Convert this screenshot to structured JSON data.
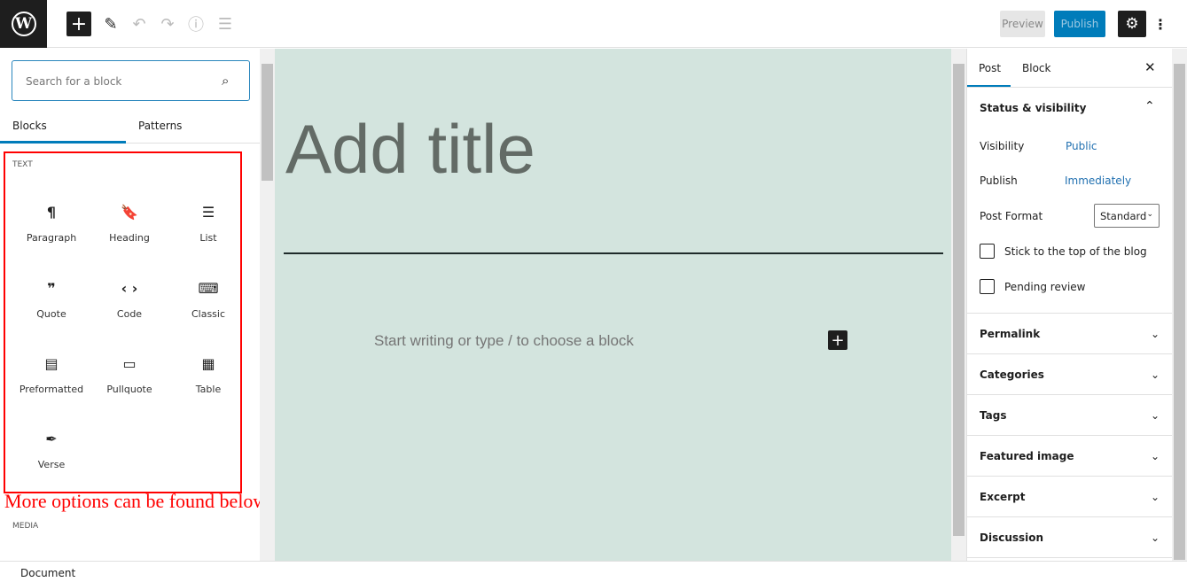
{
  "header": {
    "logo": "W",
    "preview": "Preview",
    "publish": "Publish"
  },
  "inserter": {
    "search_placeholder": "Search for a block",
    "tabs": [
      "Blocks",
      "Patterns"
    ],
    "active_tab": "Blocks",
    "category": "TEXT",
    "next_category": "MEDIA",
    "blocks": [
      {
        "label": "Paragraph",
        "icon": "¶"
      },
      {
        "label": "Heading",
        "icon": "🔖"
      },
      {
        "label": "List",
        "icon": "☰"
      },
      {
        "label": "Quote",
        "icon": "❞"
      },
      {
        "label": "Code",
        "icon": "‹ ›"
      },
      {
        "label": "Classic",
        "icon": "⌨"
      },
      {
        "label": "Preformatted",
        "icon": "▤"
      },
      {
        "label": "Pullquote",
        "icon": "▭"
      },
      {
        "label": "Table",
        "icon": "▦"
      },
      {
        "label": "Verse",
        "icon": "✒"
      }
    ]
  },
  "annotation": {
    "text": "More options can be found below",
    "color": "#ff0000"
  },
  "editor": {
    "title_placeholder": "Add title",
    "body_placeholder": "Start writing or type / to choose a block",
    "bg": "#d3e4de"
  },
  "sidebar": {
    "tabs": [
      "Post",
      "Block"
    ],
    "active_tab": "Post",
    "status_title": "Status & visibility",
    "visibility_label": "Visibility",
    "visibility_value": "Public",
    "publish_label": "Publish",
    "publish_value": "Immediately",
    "format_label": "Post Format",
    "format_value": "Standard",
    "stick_label": "Stick to the top of the blog",
    "pending_label": "Pending review",
    "panels": [
      "Permalink",
      "Categories",
      "Tags",
      "Featured image",
      "Excerpt",
      "Discussion"
    ]
  },
  "footer": {
    "breadcrumb": "Document"
  },
  "colors": {
    "accent": "#007cba",
    "dark": "#1e1e1e"
  }
}
